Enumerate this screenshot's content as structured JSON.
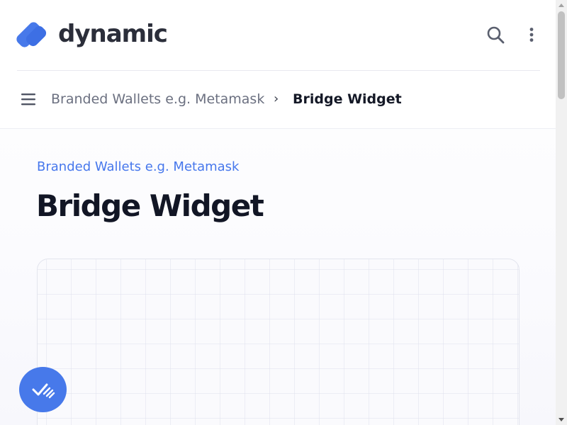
{
  "header": {
    "brand_name": "dynamic",
    "icons": {
      "logo": "dynamic-logo-icon",
      "search": "search-icon",
      "more": "more-vertical-icon"
    }
  },
  "breadcrumb": {
    "menu_icon": "hamburger-menu-icon",
    "parent_label": "Branded Wallets e.g. Metamask",
    "separator": "›",
    "current_label": "Bridge Widget"
  },
  "main": {
    "eyebrow": "Branded Wallets e.g. Metamask",
    "title": "Bridge Widget"
  },
  "fab": {
    "icon": "checklist-icon"
  },
  "colors": {
    "accent": "#4677ec",
    "title_text": "#121625",
    "muted_text": "#6b7080",
    "fab_background": "#4779ea"
  }
}
